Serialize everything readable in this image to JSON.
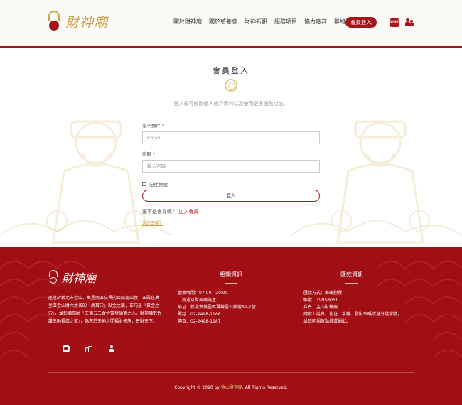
{
  "header": {
    "logo_text": "財神廟",
    "nav": [
      "關於財神廟",
      "關於慈善會",
      "財神新訊",
      "服務項目",
      "協力廠商",
      "聯絡我們"
    ],
    "login_label": "會員登入",
    "line_icon_text": "LINE"
  },
  "main": {
    "title": "會員登入",
    "intro": "登入後可修改個人帳戶資料以及使用更多服務功能。",
    "email_label": "電子郵件",
    "email_placeholder": "Email",
    "password_label": "密碼",
    "password_placeholder": "輸入密碼",
    "remember_label": "記住帳號",
    "submit_label": "登入",
    "signup_prompt": "還不是會員嗎？",
    "signup_link": "加入會員",
    "forgot_label": "忘記密碼？",
    "required_mark": "*"
  },
  "footer": {
    "logo_text": "財神廟",
    "description": "座落於新北市金山、萬里兩區交界的公館崙山腰，正殿在萬里區金山財六舊名的「虎耳穴」點金之脈，正巧是「黃金之穴」，並彰顯禪師「天德五三合佐富發福德之人，財神佛數佐護幸融福蔭之家」，為市於天地之間福財佈施，普財天下。",
    "contact_title": "相關資訊",
    "contact": [
      "營業時間：07:00 - 20:00",
      "（周週以財神廟為主）",
      "地址：新北市萬里區瑪鍊里公館崙52-2號",
      "電話：02-2498-1186",
      "傳真：02-2498-1187"
    ],
    "donate_title": "匯款資訊",
    "donate": [
      "匯款方式：郵政劃撥",
      "帳號：19958061",
      "戶名：金山財神廟",
      "請寫上姓名、住址、手機、發財密碼或身分證字號，",
      "並註明捐款點燈或捐獻。"
    ],
    "copyright_prefix": "Copyright © 2020 by ",
    "copyright_brand": "金山財神廟",
    "copyright_suffix": ". All Rights Reserved."
  }
}
